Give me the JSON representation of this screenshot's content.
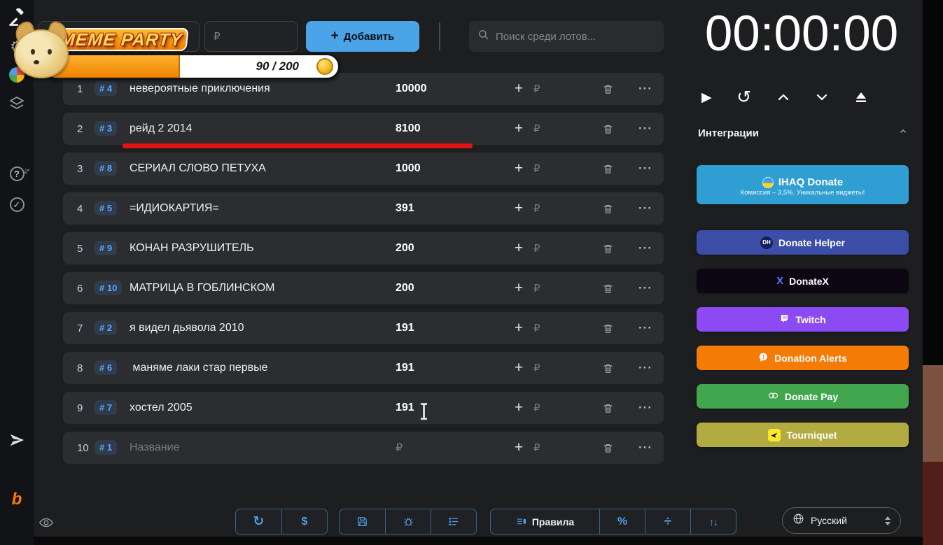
{
  "overlay": {
    "title": "MEME PARTY",
    "progress_label": "90 / 200",
    "progress_percent": 46
  },
  "topbar": {
    "lot_name_value": "",
    "price_placeholder": "₽",
    "add_button_label": "Добавить",
    "search_placeholder": "Поиск среди лотов..."
  },
  "table": {
    "rows": [
      {
        "pos": "1",
        "id": "# 4",
        "name": "невероятные приключения",
        "value": "10000"
      },
      {
        "pos": "2",
        "id": "# 3",
        "name": "рейд 2 2014",
        "value": "8100"
      },
      {
        "pos": "3",
        "id": "# 8",
        "name": "СЕРИАЛ СЛОВО ПЕТУХА",
        "value": "1000"
      },
      {
        "pos": "4",
        "id": "# 5",
        "name": "=ИДИОКАРТИЯ=",
        "value": "391"
      },
      {
        "pos": "5",
        "id": "# 9",
        "name": "КОНАН РАЗРУШИТЕЛЬ",
        "value": "200"
      },
      {
        "pos": "6",
        "id": "# 10",
        "name": "МАТРИЦА В ГОБЛИНСКОМ",
        "value": "200"
      },
      {
        "pos": "7",
        "id": "# 2",
        "name": "я видел дьявола 2010",
        "value": "191"
      },
      {
        "pos": "8",
        "id": "# 6",
        "name": " маняме лаки стар первые",
        "value": "191"
      },
      {
        "pos": "9",
        "id": "# 7",
        "name": "хостел 2005",
        "value": "191"
      },
      {
        "pos": "10",
        "id": "# 1",
        "name_placeholder": "Название",
        "value_placeholder": "₽"
      }
    ]
  },
  "timer": {
    "display": "00:00:00"
  },
  "integrations": {
    "title": "Интеграции",
    "items": [
      {
        "label": "IHAQ Donate",
        "subtitle": "Комиссия – 3,5%. Уникальные виджеты!",
        "color": "#2f9ed3"
      },
      {
        "label": "Donate Helper",
        "color": "#3c4da8",
        "icon_text": "DH"
      },
      {
        "label": "DonateX",
        "color": "#0c0713",
        "icon_text": "X"
      },
      {
        "label": "Twitch",
        "color": "#8c4bf2"
      },
      {
        "label": "Donation Alerts",
        "color": "#f57b07"
      },
      {
        "label": "Donate Pay",
        "color": "#41a64e"
      },
      {
        "label": "Tourniquet",
        "color": "#b2ab42"
      }
    ]
  },
  "footer": {
    "rules_label": "Правила",
    "language_label": "Русский"
  },
  "glyphs": {
    "plus": "+",
    "ruble": "₽",
    "more": "···",
    "gear": "⚙",
    "question": "?",
    "check": "✓",
    "boosty": "b",
    "play": "▶",
    "restart": "↺",
    "refresh": "↻",
    "dollar": "$",
    "percent": "%",
    "divide": "÷",
    "sort": "↑↓"
  },
  "annotation": {
    "underline_color": "#e01313"
  }
}
